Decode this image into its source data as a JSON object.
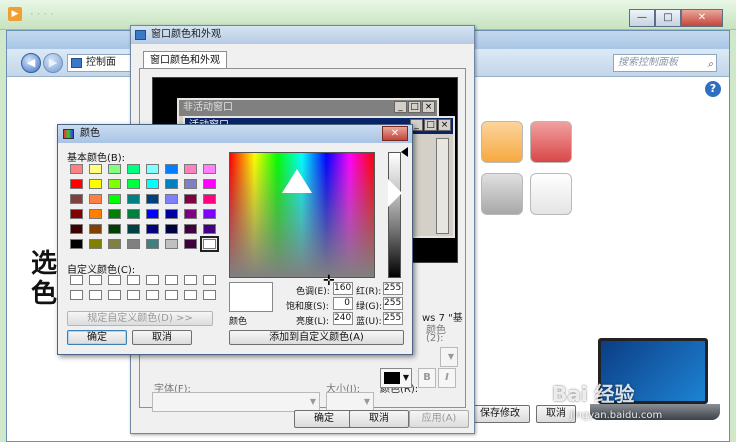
{
  "player": {},
  "control_panel": {
    "address": "控制面",
    "search_placeholder": "搜索控制面板",
    "help": "?",
    "window_buttons": [
      "—",
      "□",
      "✕"
    ],
    "save_label": "保存修改",
    "cancel_label": "取消",
    "swatch_colors": [
      "#f7a93f",
      "#d94747",
      "#b0b0b0",
      "#e9e9e9"
    ]
  },
  "handwritten": "选色",
  "appearance_dialog": {
    "title": "窗口颜色和外观",
    "tab": "窗口颜色和外观",
    "inactive_window": "非活动窗口",
    "active_window": "活动窗口",
    "win7_text": "ws 7 \"基",
    "color1_label": "颜色",
    "color1_hotkey": "(2):",
    "font_label": "字体(F):",
    "size_label": "大小(I):",
    "color2_label": "颜色(R):",
    "bold": "B",
    "italic": "I",
    "ok": "确定",
    "cancel": "取消",
    "apply": "应用(A)"
  },
  "color_dialog": {
    "title": "颜色",
    "close": "✕",
    "basic_colors_label": "基本颜色(B):",
    "custom_colors_label": "自定义颜色(C):",
    "define_custom": "规定自定义颜色(D) >>",
    "ok": "确定",
    "cancel": "取消",
    "color_solid_label": "颜色",
    "hue_label": "色调(E):",
    "hue": "160",
    "sat_label": "饱和度(S):",
    "sat": "0",
    "lum_label": "亮度(L):",
    "lum": "240",
    "red_label": "红(R):",
    "red": "255",
    "green_label": "绿(G):",
    "green": "255",
    "blue_label": "蓝(U):",
    "blue": "255",
    "add_custom": "添加到自定义颜色(A)",
    "basic_colors": [
      "#ff8080",
      "#ffff80",
      "#80ff80",
      "#00ff80",
      "#80ffff",
      "#0080ff",
      "#ff80c0",
      "#ff80ff",
      "#ff0000",
      "#ffff00",
      "#80ff00",
      "#00ff40",
      "#00ffff",
      "#0080c0",
      "#8080c0",
      "#ff00ff",
      "#804040",
      "#ff8040",
      "#00ff00",
      "#008080",
      "#004080",
      "#8080ff",
      "#800040",
      "#ff0080",
      "#800000",
      "#ff8000",
      "#008000",
      "#008040",
      "#0000ff",
      "#0000a0",
      "#800080",
      "#8000ff",
      "#400000",
      "#804000",
      "#004000",
      "#004040",
      "#000080",
      "#000040",
      "#400040",
      "#400080",
      "#000000",
      "#808000",
      "#808040",
      "#808080",
      "#408080",
      "#c0c0c0",
      "#400040",
      "#ffffff"
    ]
  },
  "watermark": {
    "text": "Bai 经验",
    "url": "jingyan.baidu.com"
  }
}
